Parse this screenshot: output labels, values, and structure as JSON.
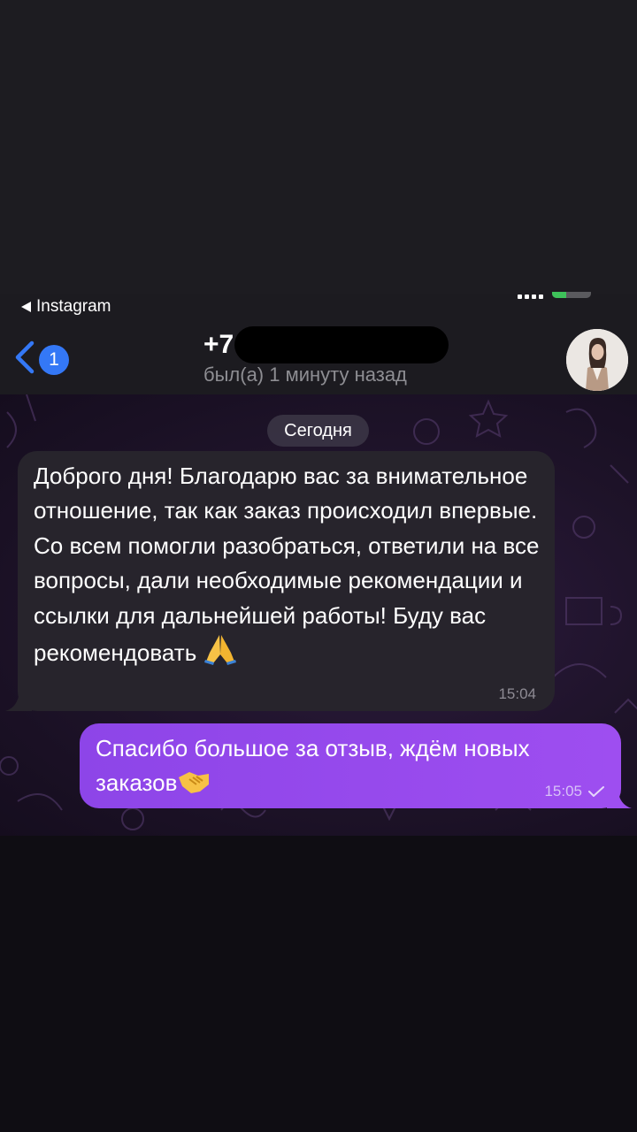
{
  "status_bar": {
    "back_app_label": "Instagram"
  },
  "header": {
    "unread_count": "1",
    "contact_name_visible": "+7",
    "last_seen": "был(а) 1 минуту назад",
    "avatar_icon": "contact-avatar-photo"
  },
  "chat": {
    "date_separator": "Сегодня",
    "messages": [
      {
        "direction": "incoming",
        "text": "Доброго дня! Благодарю вас за внимательное отношение, так как заказ происходил впервые. Со всем помогли разобраться, ответили на все вопросы, дали необходимые рекомендации и ссылки для дальнейшей работы! Буду вас рекомендовать",
        "emoji": "folded-hands-emoji",
        "time": "15:04"
      },
      {
        "direction": "outgoing",
        "text": "Спасибо большое за отзыв, ждём новых заказов",
        "emoji": "handshake-emoji",
        "time": "15:05",
        "status_icon": "single-check-icon"
      }
    ]
  },
  "colors": {
    "outgoing_bubble": "#9b4cef",
    "incoming_bubble": "#27242c",
    "badge": "#3478f6",
    "header_bg": "#1c1b20"
  }
}
